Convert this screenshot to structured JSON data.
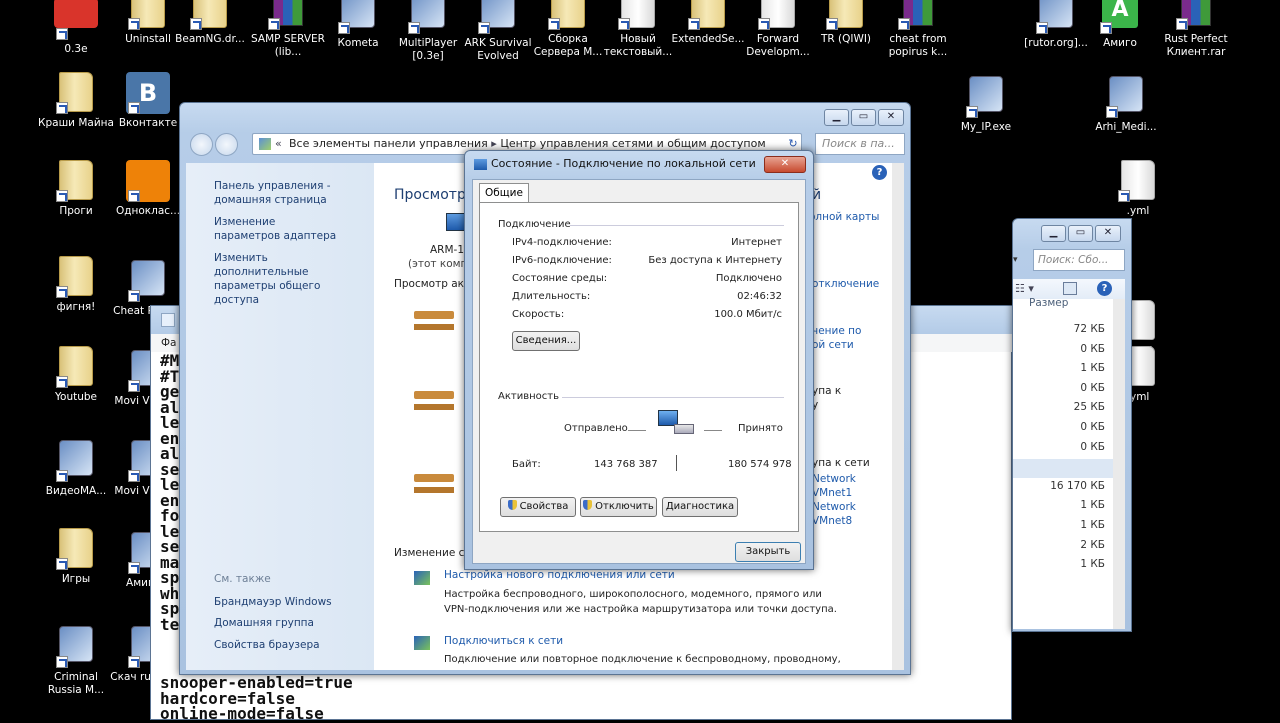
{
  "desktop_icons": [
    {
      "label": "0.3e",
      "type": "app-red"
    },
    {
      "label": "Uninstall",
      "type": "folder"
    },
    {
      "label": "BeamNG.dr...",
      "type": "folder"
    },
    {
      "label": "SAMP SERVER (lib...",
      "type": "rar"
    },
    {
      "label": "Кometa",
      "type": "app"
    },
    {
      "label": "MultiPlayer [0.3e]",
      "type": "app"
    },
    {
      "label": "ARK Survival Evolved",
      "type": "app"
    },
    {
      "label": "Сборка Сервера M...",
      "type": "folder"
    },
    {
      "label": "Новый текстовый...",
      "type": "doc"
    },
    {
      "label": "ExtendedSe...",
      "type": "folder"
    },
    {
      "label": "Forward Developm...",
      "type": "doc"
    },
    {
      "label": "TR (QIWI)",
      "type": "folder"
    },
    {
      "label": "cheat from popirus k...",
      "type": "rar"
    },
    {
      "label": "[rutor.org]...",
      "type": "app"
    },
    {
      "label": "Амиго",
      "type": "app-green"
    },
    {
      "label": "Rust Perfect Клиент.rar",
      "type": "rar"
    },
    {
      "label": "Краши Майна",
      "type": "folder"
    },
    {
      "label": "Вконтакте",
      "type": "vk"
    },
    {
      "label": "My_IP.exe",
      "type": "app"
    },
    {
      "label": "Arhi_Medi...",
      "type": "app"
    },
    {
      "label": "Проги",
      "type": "folder"
    },
    {
      "label": "Одноклас...",
      "type": "ok"
    },
    {
      "label": "фигня!",
      "type": "folder"
    },
    {
      "label": "Cheat Popir...",
      "type": "app"
    },
    {
      "label": "Youtube",
      "type": "folder"
    },
    {
      "label": "Movi Video...",
      "type": "app"
    },
    {
      "label": "ВидеоМА...",
      "type": "app"
    },
    {
      "label": "Movi Video...",
      "type": "app"
    },
    {
      "label": "Игры",
      "type": "folder"
    },
    {
      "label": "Амиго...",
      "type": "app"
    },
    {
      "label": "Criminal Russia M...",
      "type": "app"
    },
    {
      "label": "Скач rusfolo...",
      "type": "app"
    },
    {
      "label": ".yml",
      "type": "doc"
    },
    {
      "label": "ed.ini",
      "type": "doc"
    },
    {
      "label": ".yml",
      "type": "doc"
    }
  ],
  "control_panel": {
    "address_parts": [
      "Все элементы панели управления",
      "Центр управления сетями и общим доступом"
    ],
    "search_placeholder": "Поиск в па...",
    "left_links": [
      "Панель управления - домашняя страница",
      "Изменение параметров адаптера",
      "Изменить дополнительные параметры общего доступа"
    ],
    "see_also_title": "См. также",
    "see_also": [
      "Брандмауэр Windows",
      "Домашняя группа",
      "Свойства браузера"
    ],
    "header": "Просмотр",
    "header_right": "й",
    "full_map_link": "олной карты",
    "computer_name": "ARM-1",
    "computer_sub": "(этот комп",
    "active_networks_label": "Просмотр акт",
    "disconnect_link": "отключение",
    "right_links_1": [
      "чение по",
      "ой сети"
    ],
    "right_text_2": [
      "упа к",
      "у"
    ],
    "right_text_3": [
      "упа к сети"
    ],
    "vmnet": [
      "Network",
      "VMnet1",
      "Network",
      "VMnet8"
    ],
    "change_settings_label": "Изменение се",
    "tasks": [
      {
        "title": "Настройка нового подключения или сети",
        "desc": "Настройка беспроводного, широкополосного, модемного, прямого или VPN-подключения или же настройка маршрутизатора или точки доступа."
      },
      {
        "title": "Подключиться к сети",
        "desc": "Подключение или повторное подключение к беспроводному, проводному,"
      }
    ]
  },
  "status_dialog": {
    "title": "Состояние - Подключение по локальной сети",
    "tab": "Общие",
    "connection_group": "Подключение",
    "rows": [
      {
        "label": "IPv4-подключение:",
        "value": "Интернет"
      },
      {
        "label": "IPv6-подключение:",
        "value": "Без доступа к Интернету"
      },
      {
        "label": "Состояние среды:",
        "value": "Подключено"
      },
      {
        "label": "Длительность:",
        "value": "02:46:32"
      },
      {
        "label": "Скорость:",
        "value": "100.0 Мбит/с"
      }
    ],
    "details_button": "Сведения...",
    "activity_group": "Активность",
    "sent_label": "Отправлено",
    "received_label": "Принято",
    "bytes_label": "Байт:",
    "bytes_sent": "143 768 387",
    "bytes_received": "180 574 978",
    "properties_button": "Свойства",
    "disable_button": "Отключить",
    "diagnose_button": "Диагностика",
    "close_button": "Закрыть"
  },
  "explorer": {
    "search_placeholder": "Поиск: Сбо...",
    "size_header": "Размер",
    "sizes": [
      "72 КБ",
      "0 КБ",
      "1 КБ",
      "0 КБ",
      "25 КБ",
      "0 КБ",
      "0 КБ",
      "1 КБ",
      "16 170 КБ",
      "1 КБ",
      "1 КБ",
      "2 КБ",
      "1 КБ"
    ]
  },
  "notepad": {
    "menu_label": "Фа",
    "lines": [
      "#M",
      "#T",
      "ge",
      "al",
      "le",
      "en",
      "al",
      "se",
      "le",
      "en",
      "fo",
      "le",
      "se",
      "ma",
      "sp",
      "wh",
      "sp",
      "te"
    ],
    "bottom_lines": [
      "snooper-enabled=true",
      "hardcore=false",
      "online-mode=false"
    ]
  }
}
